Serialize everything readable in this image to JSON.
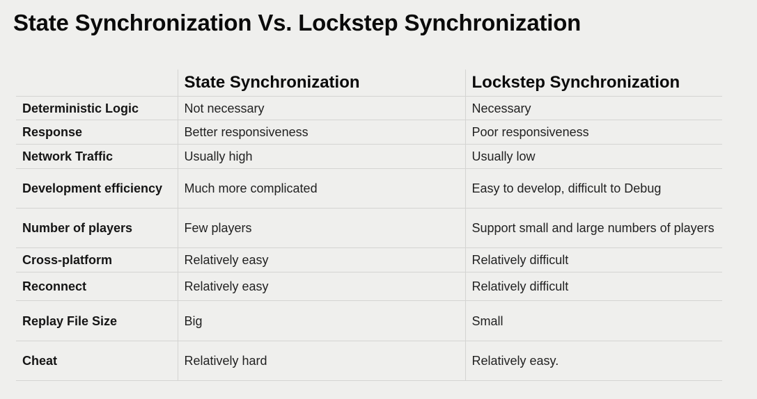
{
  "title": "State Synchronization Vs. Lockstep Synchronization",
  "table": {
    "headers": [
      "",
      "State Synchronization",
      "Lockstep Synchronization"
    ],
    "rows": [
      {
        "label": "Deterministic Logic",
        "state": "Not necessary",
        "lockstep": "Necessary"
      },
      {
        "label": "Response",
        "state": "Better responsiveness",
        "lockstep": "Poor responsiveness"
      },
      {
        "label": "Network Traffic",
        "state": "Usually high",
        "lockstep": "Usually low"
      },
      {
        "label": "Development efficiency",
        "state": "Much more complicated",
        "lockstep": "Easy to develop, difficult to Debug"
      },
      {
        "label": "Number of players",
        "state": "Few players",
        "lockstep": "Support small and large numbers of players"
      },
      {
        "label": "Cross-platform",
        "state": "Relatively easy",
        "lockstep": "Relatively difficult"
      },
      {
        "label": "Reconnect",
        "state": "Relatively easy",
        "lockstep": "Relatively difficult"
      },
      {
        "label": "Replay File Size",
        "state": "Big",
        "lockstep": "Small"
      },
      {
        "label": "Cheat",
        "state": "Relatively hard",
        "lockstep": "Relatively easy."
      }
    ]
  }
}
